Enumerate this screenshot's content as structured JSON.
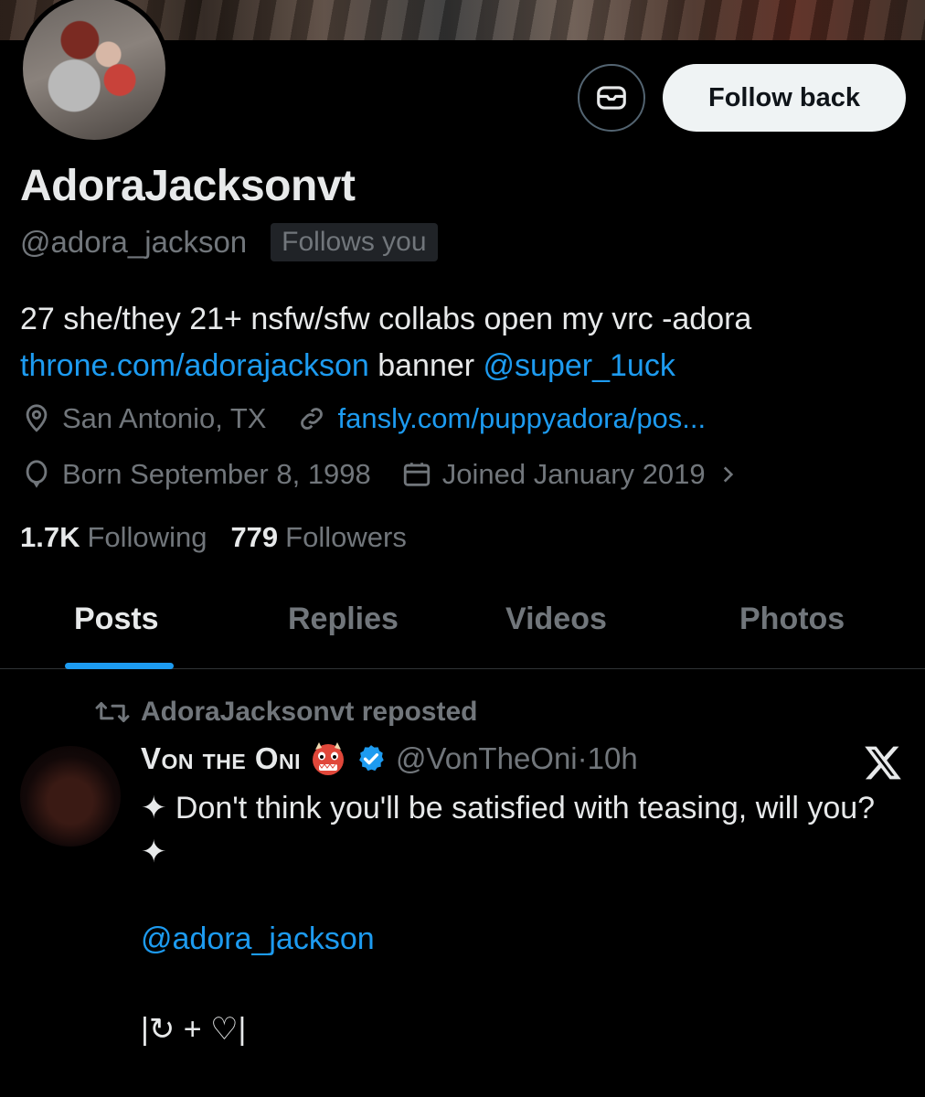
{
  "profile": {
    "name": "AdoraJacksonvt",
    "handle": "@adora_jackson",
    "follows_you": "Follows you",
    "bio_line1": "27 she/they 21+ nsfw/sfw collabs open my vrc -adora",
    "bio_link": "throne.com/adorajackson",
    "bio_mid": " banner ",
    "bio_mention": "@super_1uck",
    "location": "San Antonio, TX",
    "website": "fansly.com/puppyadora/pos...",
    "birthday": "Born September 8, 1998",
    "joined": "Joined January 2019",
    "following_count": "1.7K",
    "following_label": "Following",
    "followers_count": "779",
    "followers_label": "Followers"
  },
  "actions": {
    "follow_back": "Follow back"
  },
  "tabs": [
    {
      "label": "Posts",
      "active": true
    },
    {
      "label": "Replies",
      "active": false
    },
    {
      "label": "Videos",
      "active": false
    },
    {
      "label": "Photos",
      "active": false
    }
  ],
  "post": {
    "repost_label": "AdoraJacksonvt reposted",
    "author": "Von the Oni",
    "handle": "@VonTheOni",
    "time_sep": " · ",
    "time": "10h",
    "body": "✦ Don't think you'll be satisfied with teasing, will you? ✦",
    "mention": "@adora_jackson",
    "footer": "|↻ + ♡|"
  },
  "colors": {
    "accent": "#1d9bf0",
    "muted": "#71767b",
    "text": "#e7e9ea",
    "background": "#000000"
  },
  "icons": [
    "envelope-icon",
    "location-pin-icon",
    "link-icon",
    "balloon-icon",
    "calendar-icon",
    "chevron-right-icon",
    "repost-icon",
    "oni-mask-emoji",
    "verified-badge-icon",
    "x-logo-icon"
  ]
}
